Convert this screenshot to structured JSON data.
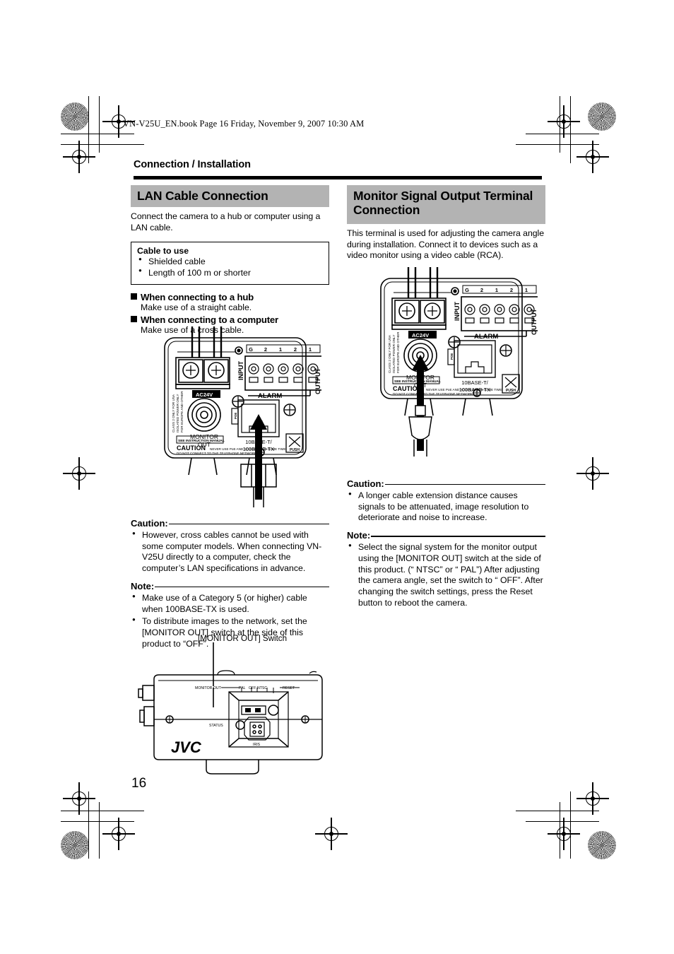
{
  "document": {
    "running_head": "VN-V25U_EN.book  Page 16  Friday, November 9, 2007  10:30 AM",
    "section_title": "Connection / Installation",
    "page_number": "16"
  },
  "left_column": {
    "banner": "LAN Cable Connection",
    "intro": "Connect the camera to a hub or computer using a LAN cable.",
    "cable_box": {
      "title": "Cable to use",
      "items": [
        "Shielded cable",
        "Length of 100 m or shorter"
      ]
    },
    "subsections": [
      {
        "heading": "When connecting to a hub",
        "text": "Make use of a straight cable."
      },
      {
        "heading": "When connecting to a computer",
        "text": "Make use of a cross cable."
      }
    ],
    "caution": {
      "label": "Caution:",
      "items": [
        "However, cross cables cannot be used with some computer models. When connecting VN-V25U directly to a computer, check the computer’s LAN specifications in advance."
      ]
    },
    "note": {
      "label": "Note:",
      "items": [
        "Make use of a Category 5 (or higher) cable when 100BASE-TX is used.",
        "To distribute images to the network, set the [MONITOR OUT] switch at the side of this product to “OFF”."
      ]
    }
  },
  "right_column": {
    "banner": "Monitor Signal Output Terminal Connection",
    "intro": "This terminal is used for adjusting the camera angle during installation. Connect it to devices such as a video monitor using a video cable (RCA).",
    "caution": {
      "label": "Caution:",
      "items": [
        "A longer cable extension distance causes signals to be attenuated, image resolution to deteriorate and noise to increase."
      ]
    },
    "note": {
      "label": "Note:",
      "items": [
        "Select the signal system for the monitor output using the [MONITOR OUT] switch at the side of this product. (“ NTSC” or “ PAL”) After adjusting the camera angle, set the switch to “ OFF”. After changing the switch settings, press the Reset button to reboot the camera."
      ]
    }
  },
  "rear_panel_figure": {
    "terminal_numbers": [
      "G",
      "2",
      "1",
      "2",
      "1"
    ],
    "input_label": "INPUT",
    "output_label": "OUTPUT",
    "alarm_label": "ALARM",
    "power_label": "AC24V",
    "monitor_label_line1": "MONITOR",
    "monitor_label_line2": "OUT",
    "class2_text": "CLASS 2 ONLY FOR USA ISOLATED POWER ONLY FOR EUROPE AND OTHER",
    "poe_tab": "POE",
    "lan_label_line1": "10BASE-T/",
    "lan_label_line2": "100BASE-TX",
    "manual_note": "SEE INSTRUCTION MANUAL",
    "caution_word": "CAUTION",
    "caution_small_1": "NEVER USE PoE AND AC 24V AT THE SAME TIME",
    "caution_small_2": "DO NOT CONNECT TO THE TELEPHONE NETWORK",
    "push_label": "PUSH"
  },
  "side_view_figure": {
    "callout": "[MONITOR OUT] Switch",
    "labels": {
      "monitor_out": "MONITOR OUT",
      "pal": "PAL",
      "off": "OFF",
      "ntsc": "NTSC",
      "reset": "RESET",
      "status": "STATUS",
      "iris": "IRIS",
      "brand": "JVC"
    }
  },
  "colors": {
    "banner_gray": "#b3b3b3",
    "rule_black": "#000000",
    "page_background": "#ffffff"
  }
}
